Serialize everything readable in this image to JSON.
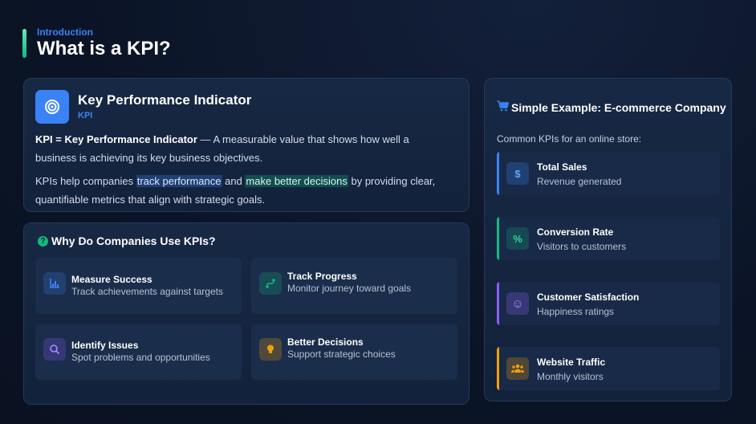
{
  "header": {
    "eyebrow": "Introduction",
    "title": "What is a KPI?"
  },
  "kpi_card": {
    "title": "Key Performance Indicator",
    "subtitle": "KPI",
    "definition_term": "KPI = Key Performance Indicator",
    "definition_text": " — A measurable value that shows how well a business is achieving its key business objectives.",
    "help_pre": "KPIs help companies ",
    "help_highlight_1": "track performance",
    "help_mid": " and ",
    "help_highlight_2": "make better decisions",
    "help_post": " by providing clear, quantifiable metrics that align with strategic goals."
  },
  "why_card": {
    "title": "Why Do Companies Use KPIs?",
    "reasons": [
      {
        "title": "Measure Success",
        "desc": "Track achievements against targets",
        "icon": "bar-chart-icon",
        "color": "#3b82f6"
      },
      {
        "title": "Track Progress",
        "desc": "Monitor journey toward goals",
        "icon": "route-icon",
        "color": "#10b981"
      },
      {
        "title": "Identify Issues",
        "desc": "Spot problems and opportunities",
        "icon": "search-icon",
        "color": "#8b5cf6"
      },
      {
        "title": "Better Decisions",
        "desc": "Support strategic choices",
        "icon": "lightbulb-icon",
        "color": "#f59e0b"
      }
    ]
  },
  "example_card": {
    "title": "Simple Example: E-commerce Company",
    "intro": "Common KPIs for an online store:",
    "metrics": [
      {
        "title": "Total Sales",
        "desc": "Revenue generated",
        "icon": "dollar-icon",
        "glyph": "$",
        "color": "#3b82f6"
      },
      {
        "title": "Conversion Rate",
        "desc": "Visitors to customers",
        "icon": "percent-icon",
        "glyph": "%",
        "color": "#10b981"
      },
      {
        "title": "Customer Satisfaction",
        "desc": "Happiness ratings",
        "icon": "smile-icon",
        "glyph": "☺",
        "color": "#8b5cf6"
      },
      {
        "title": "Website Traffic",
        "desc": "Monthly visitors",
        "icon": "users-icon",
        "glyph": "",
        "color": "#f59e0b"
      }
    ]
  }
}
